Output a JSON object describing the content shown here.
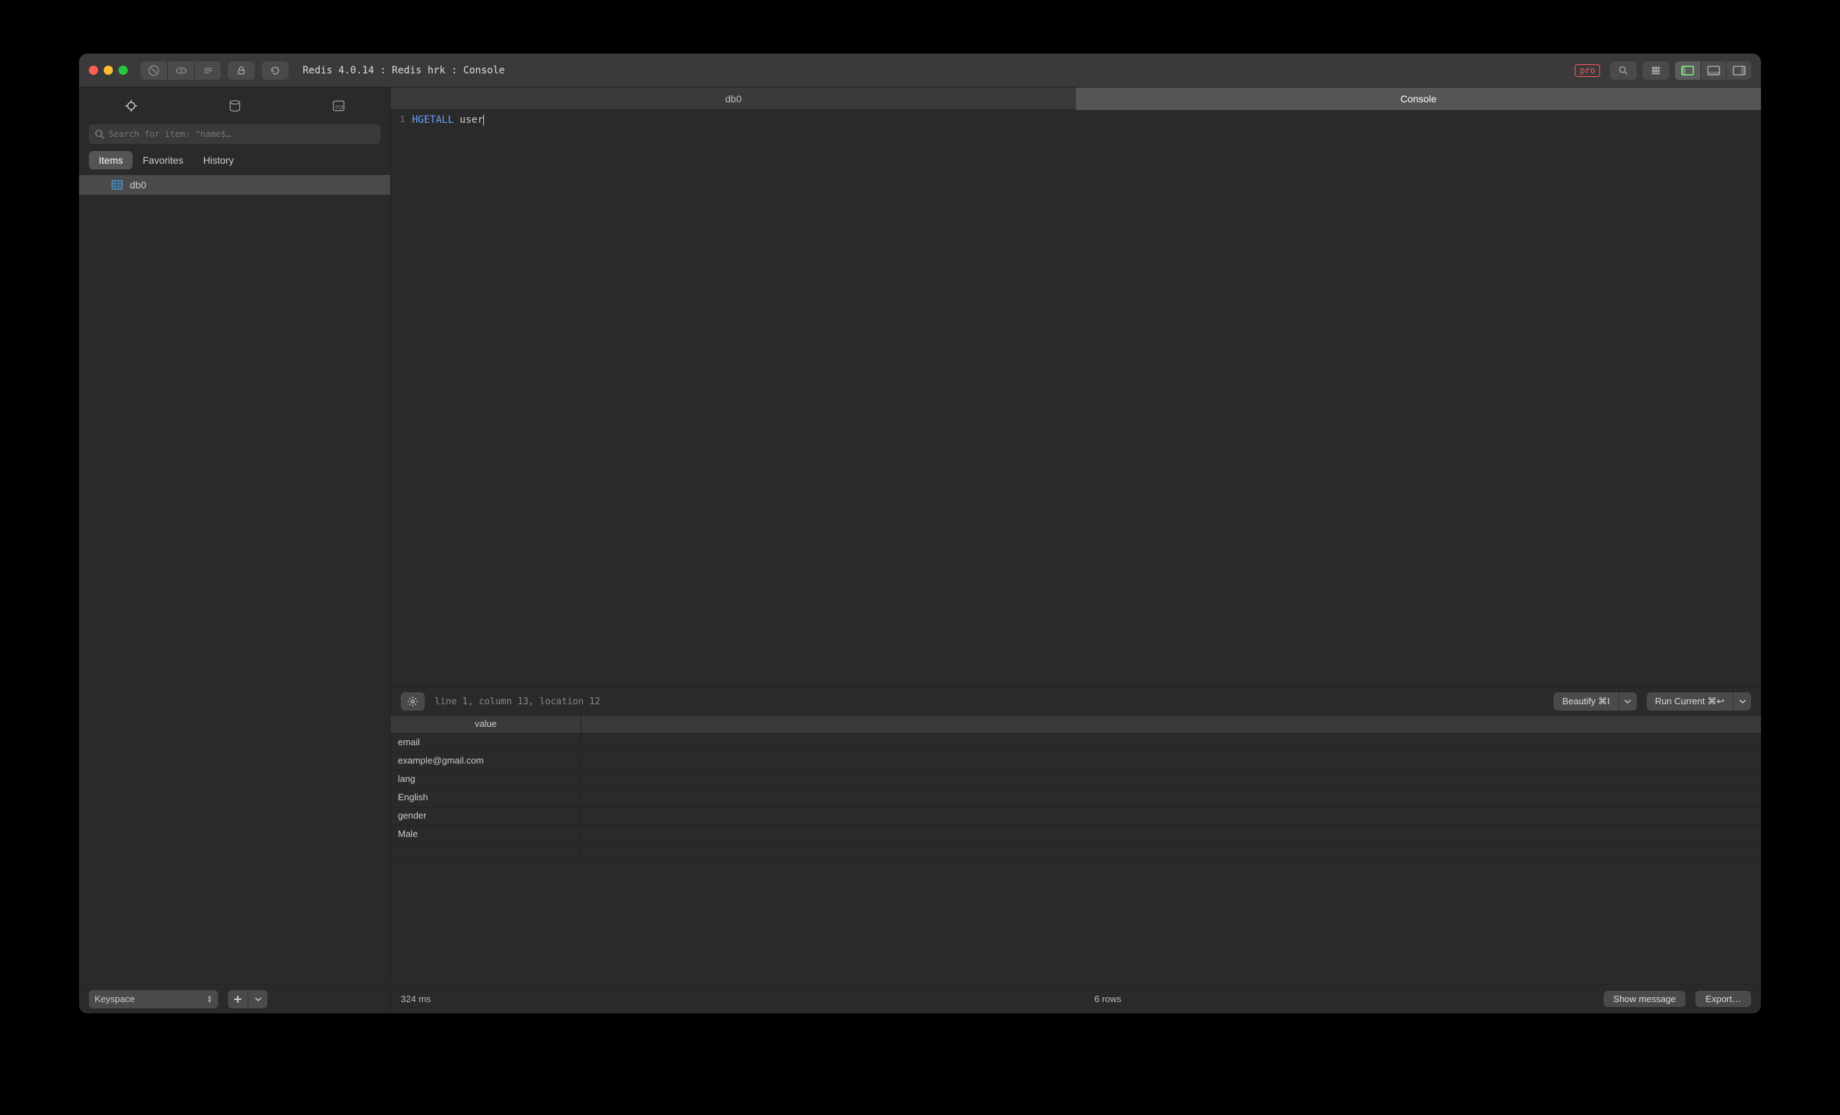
{
  "titlebar": {
    "title": "Redis 4.0.14 : Redis hrk : Console",
    "pro_badge": "pro"
  },
  "sidebar": {
    "search_placeholder": "Search for item: ^name$…",
    "tabs": {
      "items": "Items",
      "favorites": "Favorites",
      "history": "History"
    },
    "list": [
      {
        "label": "db0"
      }
    ],
    "keyspace_label": "Keyspace"
  },
  "main_tabs": {
    "db0": "db0",
    "console": "Console"
  },
  "editor": {
    "line_no": "1",
    "keyword": "HGETALL",
    "arg": "user",
    "status": "line 1, column 13, location 12",
    "beautify": "Beautify ⌘I",
    "run": "Run Current ⌘↩"
  },
  "results": {
    "header": "value",
    "rows": [
      "email",
      "example@gmail.com",
      "lang",
      "English",
      "gender",
      "Male"
    ]
  },
  "bottom": {
    "time": "324 ms",
    "rows": "6 rows",
    "show_message": "Show message",
    "export": "Export…"
  }
}
